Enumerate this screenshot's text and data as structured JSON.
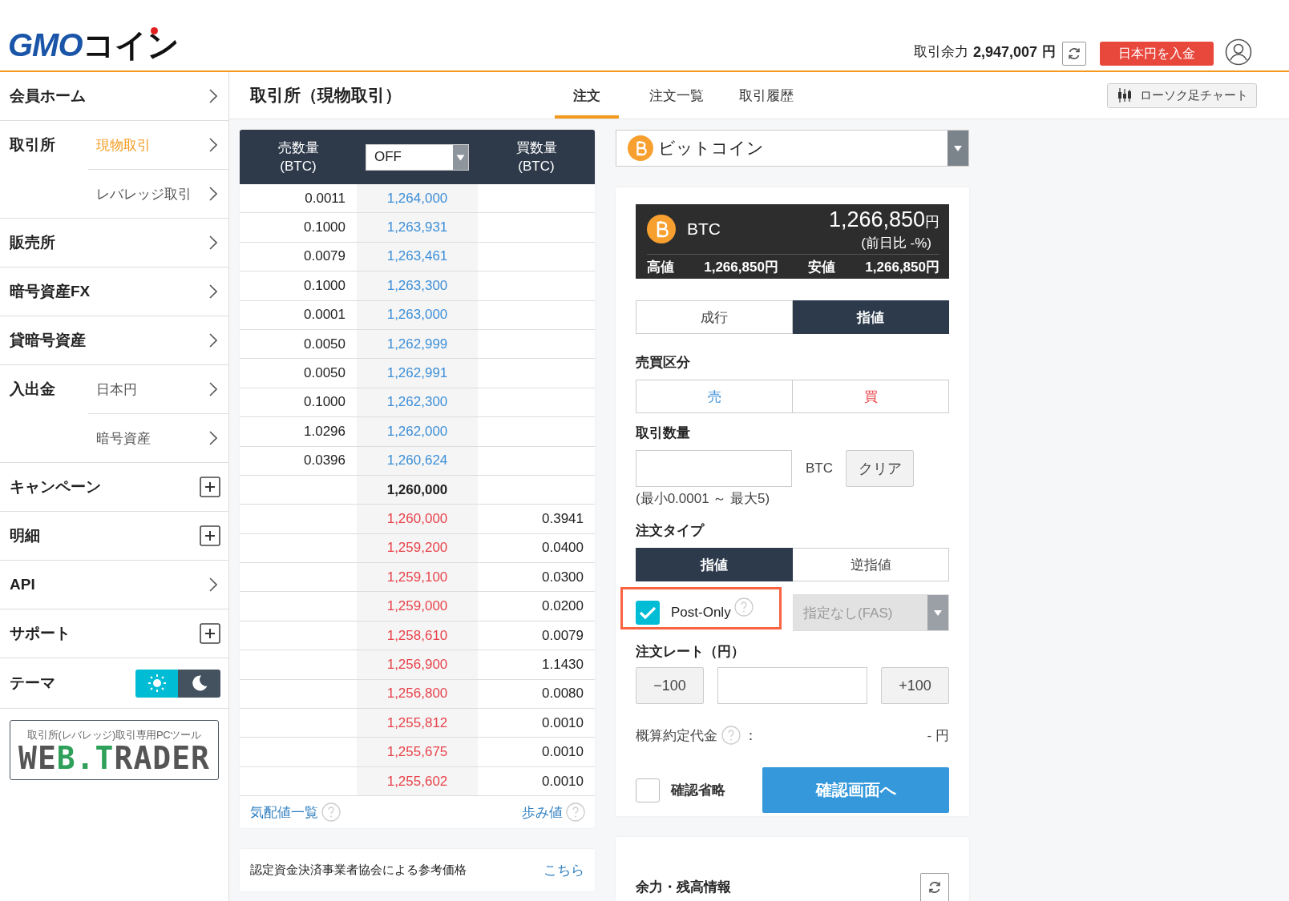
{
  "header": {
    "logo": {
      "latin": "GMO",
      "kana": "コイン"
    },
    "balance_label": "取引余力",
    "balance_value": "2,947,007",
    "balance_unit": "円",
    "deposit_button": "日本円を入金"
  },
  "sidebar": {
    "items": [
      {
        "label": "会員ホーム",
        "kind": "link"
      },
      {
        "label": "取引所",
        "kind": "group",
        "children": [
          {
            "label": "現物取引",
            "selected": true
          },
          {
            "label": "レバレッジ取引",
            "selected": false
          }
        ]
      },
      {
        "label": "販売所",
        "kind": "link"
      },
      {
        "label": "暗号資産FX",
        "kind": "link"
      },
      {
        "label": "貸暗号資産",
        "kind": "link"
      },
      {
        "label": "入出金",
        "kind": "group",
        "children": [
          {
            "label": "日本円",
            "selected": false
          },
          {
            "label": "暗号資産",
            "selected": false
          }
        ]
      },
      {
        "label": "キャンペーン",
        "kind": "expand"
      },
      {
        "label": "明細",
        "kind": "expand"
      },
      {
        "label": "API",
        "kind": "link"
      },
      {
        "label": "サポート",
        "kind": "expand"
      }
    ],
    "theme": {
      "label": "テーマ",
      "options": [
        {
          "kind": "light",
          "selected": true
        },
        {
          "kind": "dark",
          "selected": false
        }
      ]
    },
    "banner": {
      "caption": "取引所(レバレッジ)取引専用PCツール",
      "logo": [
        {
          "text": "WE",
          "highlight": false
        },
        {
          "text": "B.T",
          "highlight": true
        },
        {
          "text": "RADER",
          "highlight": false
        }
      ]
    }
  },
  "page": {
    "title": "取引所（現物取引）",
    "tabs": [
      {
        "label": "注文",
        "selected": true
      },
      {
        "label": "注文一覧",
        "selected": false
      },
      {
        "label": "取引履歴",
        "selected": false
      }
    ],
    "chart_button": "ローソク足チャート"
  },
  "order_book": {
    "sell_header": [
      "売数量",
      "(BTC)"
    ],
    "buy_header": [
      "買数量",
      "(BTC)"
    ],
    "grouping": "OFF",
    "rows": [
      {
        "kind": "ask",
        "qty": "0.0011",
        "price": "1,264,000"
      },
      {
        "kind": "ask",
        "qty": "0.1000",
        "price": "1,263,931"
      },
      {
        "kind": "ask",
        "qty": "0.0079",
        "price": "1,263,461"
      },
      {
        "kind": "ask",
        "qty": "0.1000",
        "price": "1,263,300"
      },
      {
        "kind": "ask",
        "qty": "0.0001",
        "price": "1,263,000"
      },
      {
        "kind": "ask",
        "qty": "0.0050",
        "price": "1,262,999"
      },
      {
        "kind": "ask",
        "qty": "0.0050",
        "price": "1,262,991"
      },
      {
        "kind": "ask",
        "qty": "0.1000",
        "price": "1,262,300"
      },
      {
        "kind": "ask",
        "qty": "1.0296",
        "price": "1,262,000"
      },
      {
        "kind": "ask",
        "qty": "0.0396",
        "price": "1,260,624"
      },
      {
        "kind": "mid",
        "price": "1,260,000"
      },
      {
        "kind": "bid",
        "qty": "0.3941",
        "price": "1,260,000"
      },
      {
        "kind": "bid",
        "qty": "0.0400",
        "price": "1,259,200"
      },
      {
        "kind": "bid",
        "qty": "0.0300",
        "price": "1,259,100"
      },
      {
        "kind": "bid",
        "qty": "0.0200",
        "price": "1,259,000"
      },
      {
        "kind": "bid",
        "qty": "0.0079",
        "price": "1,258,610"
      },
      {
        "kind": "bid",
        "qty": "1.1430",
        "price": "1,256,900"
      },
      {
        "kind": "bid",
        "qty": "0.0080",
        "price": "1,256,800"
      },
      {
        "kind": "bid",
        "qty": "0.0010",
        "price": "1,255,812"
      },
      {
        "kind": "bid",
        "qty": "0.0010",
        "price": "1,255,675"
      },
      {
        "kind": "bid",
        "qty": "0.0010",
        "price": "1,255,602"
      }
    ],
    "links": [
      "気配値一覧",
      "歩み値"
    ]
  },
  "reference": {
    "text": "認定資金決済事業者協会による参考価格",
    "link": "こちら"
  },
  "order_panel": {
    "coin": "ビットコイン",
    "ticker": {
      "symbol": "BTC",
      "price": "1,266,850",
      "unit": "円",
      "change": "(前日比 -%)",
      "high_label": "高値",
      "high": "1,266,850円",
      "low_label": "安値",
      "low": "1,266,850円"
    },
    "exec_types": [
      {
        "label": "成行",
        "selected": false
      },
      {
        "label": "指値",
        "selected": true
      }
    ],
    "side_label": "売買区分",
    "sides": [
      {
        "label": "売",
        "kind": "sell",
        "selected": false
      },
      {
        "label": "買",
        "kind": "buy",
        "selected": false
      }
    ],
    "qty_label": "取引数量",
    "qty_unit": "BTC",
    "clear_button": "クリア",
    "qty_range": "(最小0.0001 ～ 最大5)",
    "type_label": "注文タイプ",
    "order_types": [
      {
        "label": "指値",
        "selected": true
      },
      {
        "label": "逆指値",
        "selected": false
      }
    ],
    "post_only": {
      "label": "Post-Only",
      "checked": true,
      "highlighted": true
    },
    "tif": {
      "value": "指定なし(FAS)",
      "disabled": true
    },
    "rate_label": "注文レート（円）",
    "minus_button": "−100",
    "plus_button": "+100",
    "estimate_label": "概算約定代金",
    "estimate_colon": "：",
    "estimate_value": "- 円",
    "skip_confirm": {
      "label": "確認省略",
      "checked": false
    },
    "confirm_button": "確認画面へ"
  },
  "balance_panel": {
    "title": "余力・残高情報"
  }
}
